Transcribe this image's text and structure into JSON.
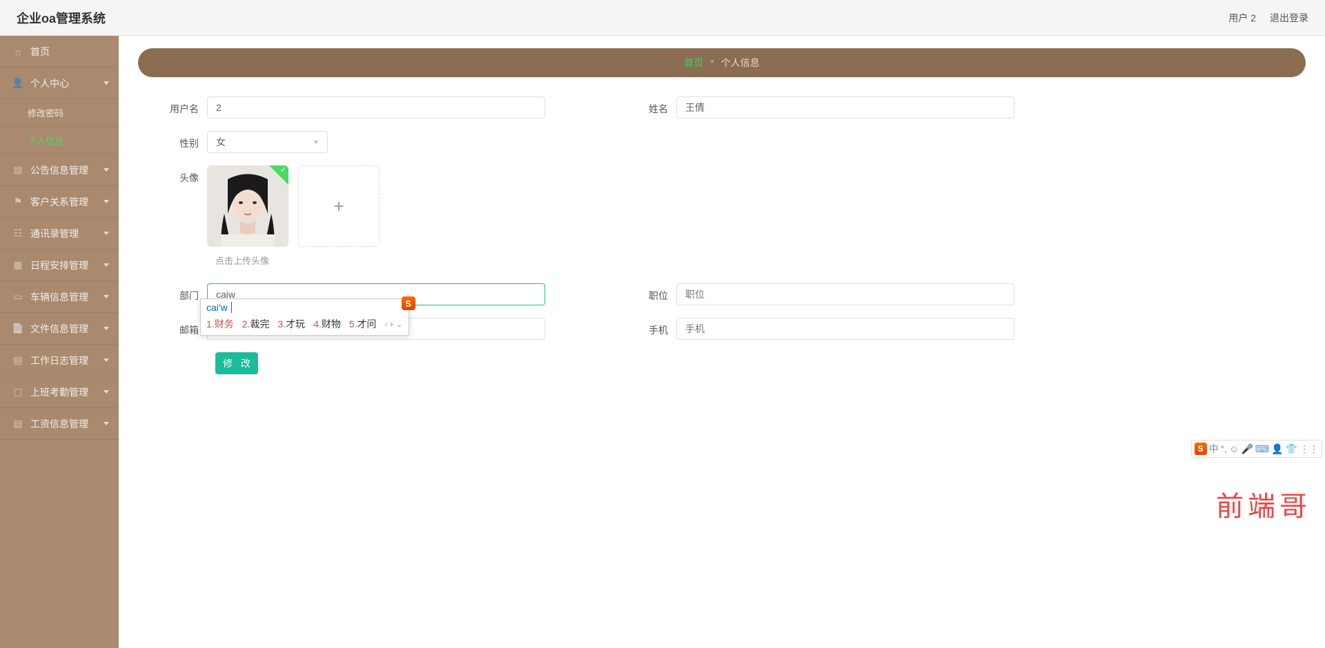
{
  "header": {
    "title": "企业oa管理系统",
    "user": "用户 2",
    "logout": "退出登录"
  },
  "sidebar": {
    "items": [
      {
        "label": "首页",
        "icon": "home"
      },
      {
        "label": "个人中心",
        "icon": "user",
        "children": [
          {
            "label": "修改密码",
            "active": false
          },
          {
            "label": "个人信息",
            "active": true
          }
        ]
      },
      {
        "label": "公告信息管理",
        "icon": "doc"
      },
      {
        "label": "客户关系管理",
        "icon": "flag"
      },
      {
        "label": "通讯录管理",
        "icon": "contacts"
      },
      {
        "label": "日程安排管理",
        "icon": "calendar"
      },
      {
        "label": "车辆信息管理",
        "icon": "car"
      },
      {
        "label": "文件信息管理",
        "icon": "file"
      },
      {
        "label": "工作日志管理",
        "icon": "log"
      },
      {
        "label": "上班考勤管理",
        "icon": "attendance"
      },
      {
        "label": "工资信息管理",
        "icon": "salary"
      }
    ]
  },
  "breadcrumb": {
    "home": "首页",
    "separator": "*",
    "current": "个人信息"
  },
  "form": {
    "username_label": "用户名",
    "username_value": "2",
    "name_label": "姓名",
    "name_value": "王倩",
    "gender_label": "性别",
    "gender_value": "女",
    "avatar_label": "头像",
    "avatar_hint": "点击上传头像",
    "dept_label": "部门",
    "dept_value": "caiw",
    "position_label": "职位",
    "position_placeholder": "职位",
    "email_label": "邮箱",
    "phone_label": "手机",
    "phone_placeholder": "手机",
    "submit_label": "修 改"
  },
  "ime": {
    "composition": "cai'w",
    "badge": "S",
    "candidates": [
      {
        "num": "1.",
        "text": "财务"
      },
      {
        "num": "2.",
        "text": "裁完"
      },
      {
        "num": "3.",
        "text": "才玩"
      },
      {
        "num": "4.",
        "text": "财物"
      },
      {
        "num": "5.",
        "text": "才问"
      }
    ],
    "nav_prev": "‹",
    "nav_next": "›",
    "nav_down": "⌄",
    "toolbar": {
      "badge": "S",
      "lang": "中",
      "icons": [
        "°,",
        "☺",
        "🎤",
        "⌨",
        "👤",
        "👕",
        "⋮⋮"
      ]
    }
  },
  "watermark": "前端哥"
}
